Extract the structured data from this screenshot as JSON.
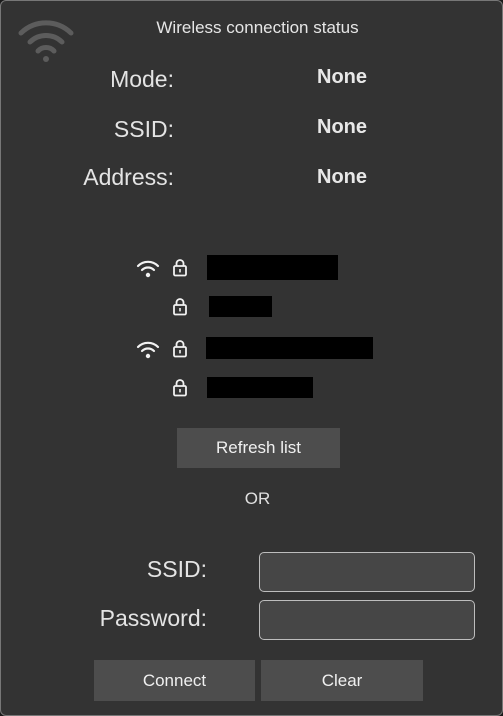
{
  "header": {
    "title": "Wireless connection status",
    "logo_icon": "wifi-icon"
  },
  "status": {
    "mode_label": "Mode:",
    "mode_value": "None",
    "ssid_label": "SSID:",
    "ssid_value": "None",
    "address_label": "Address:",
    "address_value": "None"
  },
  "networks": [
    {
      "signal_icon": "wifi-signal-icon",
      "secured": true,
      "name_redacted": true
    },
    {
      "signal_icon": null,
      "secured": true,
      "name_redacted": true
    },
    {
      "signal_icon": "wifi-signal-icon",
      "secured": true,
      "name_redacted": true
    },
    {
      "signal_icon": null,
      "secured": true,
      "name_redacted": true
    }
  ],
  "actions": {
    "refresh_label": "Refresh list",
    "or_text": "OR"
  },
  "form": {
    "ssid_label": "SSID:",
    "ssid_value": "",
    "password_label": "Password:",
    "password_value": "",
    "connect_label": "Connect",
    "clear_label": "Clear"
  },
  "colors": {
    "panel_background": "#333333",
    "button_background": "#4d4d4d",
    "redaction": "#000000"
  }
}
